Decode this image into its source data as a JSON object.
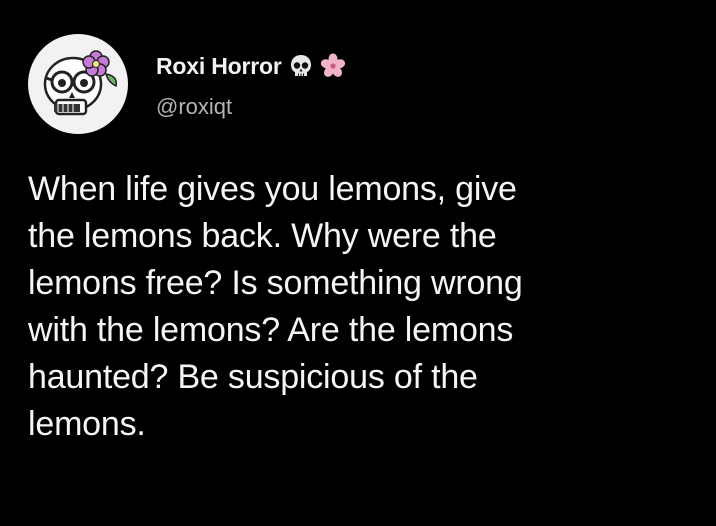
{
  "tweet": {
    "author": {
      "display_name": "Roxi Horror",
      "handle": "@roxiqt",
      "name_emojis": [
        "skull-emoji",
        "cherry-blossom-emoji"
      ],
      "avatar": "skull-with-flower-avatar"
    },
    "lines": [
      "When life gives you lemons, give",
      "the lemons back. Why were the",
      "lemons free? Is something wrong",
      "with the lemons? Are the lemons",
      "haunted? Be suspicious of the",
      "lemons."
    ]
  },
  "colors": {
    "background": "#000000",
    "text": "#f5f5f5",
    "handle": "#b4b4b4",
    "avatar_bg": "#f4f1f4",
    "flower": "#c47ad6"
  }
}
